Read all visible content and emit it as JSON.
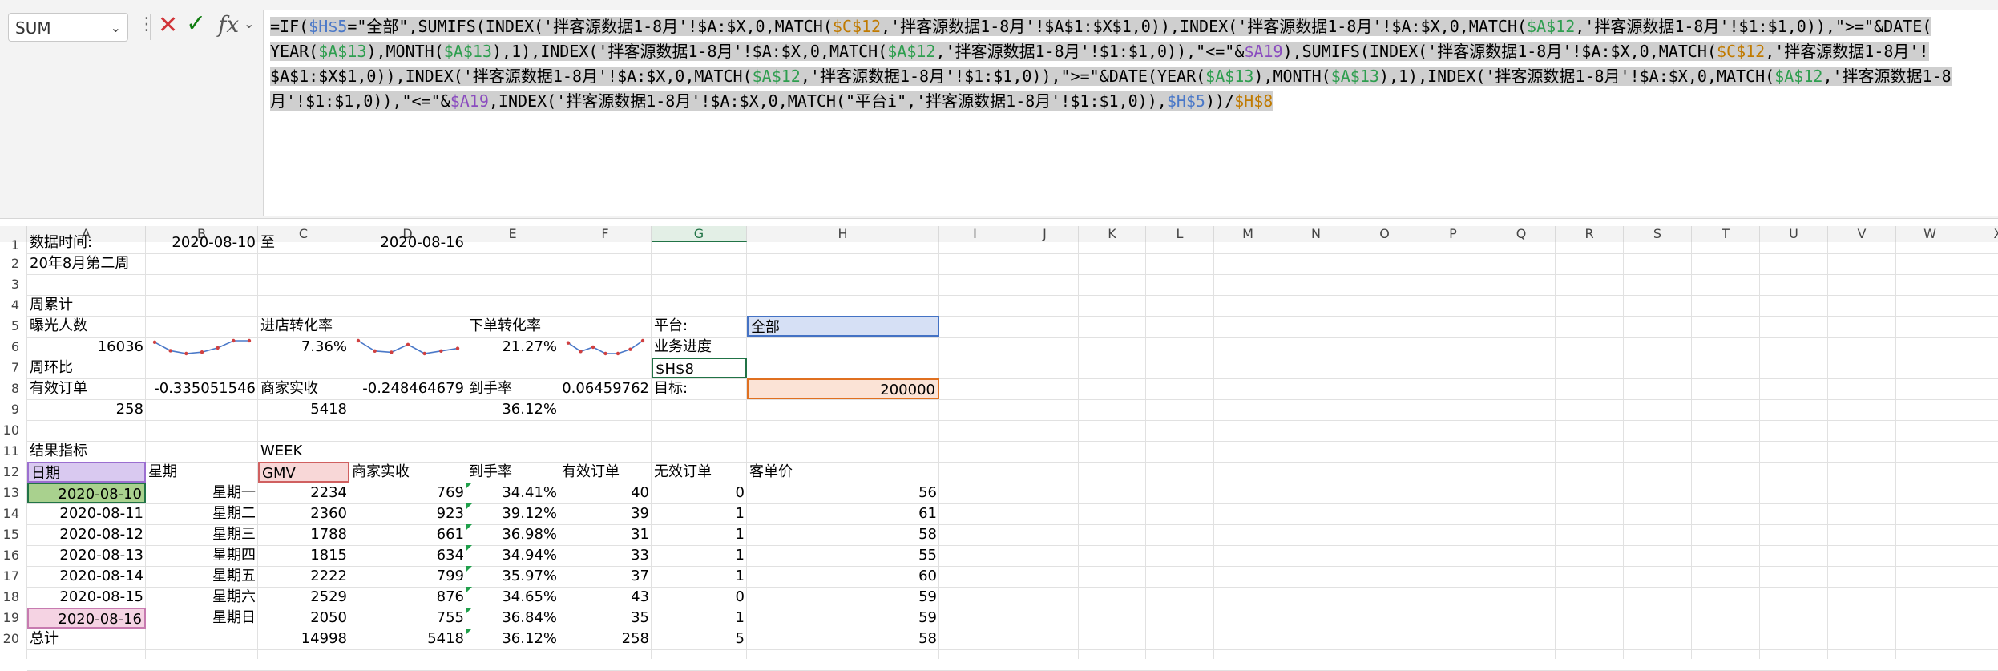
{
  "namebox": {
    "value": "SUM"
  },
  "formula": {
    "lines": [
      "=IF($H$5=\"全部\",SUMIFS(INDEX('拌客源数据1-8月'!$A:$X,0,MATCH($C$12,'拌客源数据1-8月'!$A$1:$X$1,0)),INDEX('拌客源数据1-8月'!$A:$X,0,MATCH($A$12,'拌客源数据1-8月'!$1:$1,0)),\">=\"&DATE(",
      "YEAR($A$13),MONTH($A$13),1),INDEX('拌客源数据1-8月'!$A:$X,0,MATCH($A$12,'拌客源数据1-8月'!$1:$1,0)),\"<=\"&$A19),SUMIFS(INDEX('拌客源数据1-8月'!$A:$X,0,MATCH($C$12,'拌客源数据1-8月'!",
      "$A$1:$X$1,0)),INDEX('拌客源数据1-8月'!$A:$X,0,MATCH($A$12,'拌客源数据1-8月'!$1:$1,0)),\">=\"&DATE(YEAR($A$13),MONTH($A$13),1),INDEX('拌客源数据1-8月'!$A:$X,0,MATCH($A$12,'拌客源数据1-8",
      "月'!$1:$1,0)),\"<=\"&$A19,INDEX('拌客源数据1-8月'!$A:$X,0,MATCH(\"平台i\",'拌客源数据1-8月'!$1:$1,0)),$H$5))/$H$8"
    ]
  },
  "columns": [
    "A",
    "B",
    "C",
    "D",
    "E",
    "F",
    "G",
    "H",
    "I",
    "J",
    "K",
    "L",
    "M",
    "N",
    "O",
    "P",
    "Q",
    "R",
    "S",
    "T",
    "U",
    "V",
    "W",
    "X"
  ],
  "rows": [
    "1",
    "2",
    "3",
    "4",
    "5",
    "6",
    "7",
    "8",
    "9",
    "10",
    "11",
    "12",
    "13",
    "14",
    "15",
    "16",
    "17",
    "18",
    "19",
    "20"
  ],
  "top": {
    "r1a": "数据时间:",
    "r1b": "2020-08-10",
    "r1c": "至",
    "r1d": "2020-08-16",
    "r2a": "20年8月第二周",
    "r4a": "周累计",
    "r5a": "曝光人数",
    "r5c": "进店转化率",
    "r5e": "下单转化率",
    "r5g": "平台:",
    "r5h": "全部",
    "r6a": "16036",
    "r6c": "7.36%",
    "r6e": "21.27%",
    "r6g": "业务进度",
    "r7a": "周环比",
    "r7g": "$H$8",
    "r8a": "有效订单",
    "r8b": "-0.335051546",
    "r8c": "商家实收",
    "r8d": "-0.248464679",
    "r8e": "到手率",
    "r8f": "0.06459762",
    "r8g": "目标:",
    "r8h": "200000",
    "r9a": "258",
    "r9c": "5418",
    "r9e": "36.12%",
    "r11a": "结果指标",
    "r11c": "WEEK"
  },
  "table": {
    "headers": [
      "日期",
      "星期",
      "GMV",
      "商家实收",
      "到手率",
      "有效订单",
      "无效订单",
      "客单价"
    ],
    "rows": [
      [
        "2020-08-10",
        "星期一",
        "2234",
        "769",
        "34.41%",
        "40",
        "0",
        "56"
      ],
      [
        "2020-08-11",
        "星期二",
        "2360",
        "923",
        "39.12%",
        "39",
        "1",
        "61"
      ],
      [
        "2020-08-12",
        "星期三",
        "1788",
        "661",
        "36.98%",
        "31",
        "1",
        "58"
      ],
      [
        "2020-08-13",
        "星期四",
        "1815",
        "634",
        "34.94%",
        "33",
        "1",
        "55"
      ],
      [
        "2020-08-14",
        "星期五",
        "2222",
        "799",
        "35.97%",
        "37",
        "1",
        "60"
      ],
      [
        "2020-08-15",
        "星期六",
        "2529",
        "876",
        "34.65%",
        "43",
        "0",
        "59"
      ],
      [
        "2020-08-16",
        "星期日",
        "2050",
        "755",
        "36.84%",
        "35",
        "1",
        "59"
      ]
    ],
    "total": [
      "总计",
      "",
      "14998",
      "5418",
      "36.12%",
      "258",
      "5",
      "58"
    ]
  },
  "sparklines": {
    "exposure": [
      22,
      16,
      14,
      15,
      18,
      23,
      23
    ],
    "store_conv": [
      22,
      14,
      13,
      19,
      12,
      14,
      16
    ],
    "order_conv": [
      18,
      14,
      16,
      13,
      13,
      15,
      19
    ]
  },
  "colors": {
    "accent_green": "#217346",
    "date_header_fill": "#d9c9f0",
    "gmv_header_fill": "#f8d7d7",
    "a13_fill": "#a9d18e",
    "a19_fill": "#f5d3e3",
    "h5_fill": "#d6e0f5",
    "h8_fill": "#fbe3d6",
    "formula_blue": "#4a78c8",
    "formula_green": "#2e9e4f",
    "formula_purple": "#8a4bbf",
    "formula_orange": "#c07a00",
    "formula_red": "#c0392b"
  }
}
